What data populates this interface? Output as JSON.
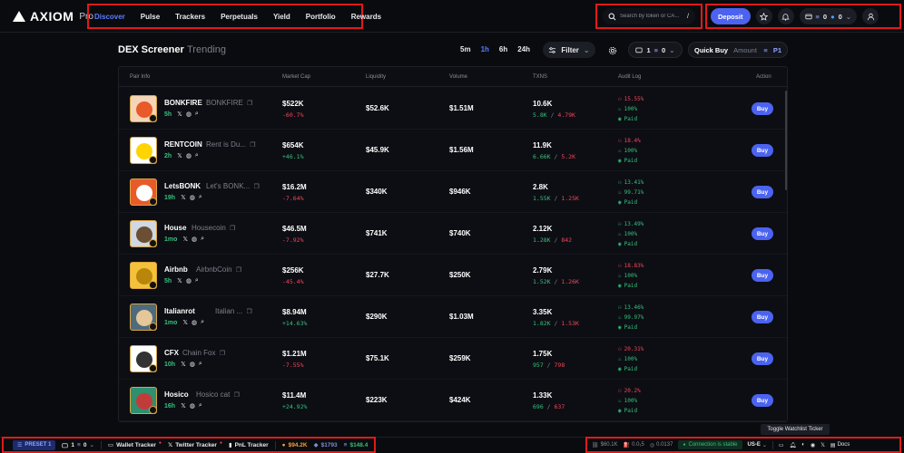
{
  "header": {
    "logo_text": "AXIOM",
    "logo_sub": "Pro",
    "nav": [
      "Discover",
      "Pulse",
      "Trackers",
      "Perpetuals",
      "Yield",
      "Portfolio",
      "Rewards"
    ],
    "search_placeholder": "Search by token or CA...",
    "search_shortcut": "/",
    "deposit_label": "Deposit",
    "wallet_sol": "0",
    "wallet_usdc": "0"
  },
  "toolbar": {
    "title": "DEX Screener",
    "trending": "Trending",
    "timeframes": [
      "5m",
      "1h",
      "6h",
      "24h"
    ],
    "active_timeframe": "1h",
    "filter_label": "Filter",
    "preset_count": "1",
    "preset_value": "0",
    "quick_buy_label": "Quick Buy",
    "amount_label": "Amount",
    "preset_tag": "P1"
  },
  "table": {
    "headers": [
      "Pair Info",
      "Market Cap",
      "Liquidity",
      "Volume",
      "TXNS",
      "Audit Log",
      "Action"
    ],
    "buy_label": "Buy",
    "rows": [
      {
        "symbol": "BONKFIRE",
        "name": "BONKFIRE",
        "age": "5h",
        "mc": "$522K",
        "mc_change": "-60.7%",
        "liq": "$52.6K",
        "vol": "$1.51M",
        "txns": "10.6K",
        "buys": "5.8K",
        "sells": "4.79K",
        "audit1": "15.55%",
        "audit2": "100%",
        "audit3": "Paid"
      },
      {
        "symbol": "RENTCOIN",
        "name": "Rent is Du...",
        "age": "2h",
        "mc": "$654K",
        "mc_change": "+46.1%",
        "liq": "$45.9K",
        "vol": "$1.56M",
        "txns": "11.9K",
        "buys": "6.66K",
        "sells": "5.2K",
        "audit1": "18.4%",
        "audit2": "100%",
        "audit3": "Paid"
      },
      {
        "symbol": "LetsBONK",
        "name": "Let's BONK...",
        "age": "19h",
        "mc": "$16.2M",
        "mc_change": "-7.64%",
        "liq": "$340K",
        "vol": "$946K",
        "txns": "2.8K",
        "buys": "1.55K",
        "sells": "1.25K",
        "audit1": "13.41%",
        "audit2": "99.71%",
        "audit3": "Paid"
      },
      {
        "symbol": "House",
        "name": "Housecoin",
        "age": "1mo",
        "mc": "$46.5M",
        "mc_change": "-7.92%",
        "liq": "$741K",
        "vol": "$740K",
        "txns": "2.12K",
        "buys": "1.28K",
        "sells": "842",
        "audit1": "13.49%",
        "audit2": "100%",
        "audit3": "Paid"
      },
      {
        "symbol": "Airbnb",
        "name": "AirbnbCoin",
        "age": "5h",
        "mc": "$256K",
        "mc_change": "-45.4%",
        "liq": "$27.7K",
        "vol": "$250K",
        "txns": "2.79K",
        "buys": "1.52K",
        "sells": "1.26K",
        "audit1": "18.83%",
        "audit2": "100%",
        "audit3": "Paid"
      },
      {
        "symbol": "Italianrot",
        "name": "Italian ...",
        "age": "1mo",
        "mc": "$8.94M",
        "mc_change": "+14.63%",
        "liq": "$290K",
        "vol": "$1.03M",
        "txns": "3.35K",
        "buys": "1.82K",
        "sells": "1.53K",
        "audit1": "13.46%",
        "audit2": "99.97%",
        "audit3": "Paid"
      },
      {
        "symbol": "CFX",
        "name": "Chain Fox",
        "age": "10h",
        "mc": "$1.21M",
        "mc_change": "-7.55%",
        "liq": "$75.1K",
        "vol": "$259K",
        "txns": "1.75K",
        "buys": "957",
        "sells": "798",
        "audit1": "20.31%",
        "audit2": "100%",
        "audit3": "Paid"
      },
      {
        "symbol": "Hosico",
        "name": "Hosico cat",
        "age": "16h",
        "mc": "$11.4M",
        "mc_change": "+24.92%",
        "liq": "$223K",
        "vol": "$424K",
        "txns": "1.33K",
        "buys": "696",
        "sells": "637",
        "audit1": "20.2%",
        "audit2": "100%",
        "audit3": "Paid"
      }
    ]
  },
  "tooltip": "Toggle Watchlist Ticker",
  "footer": {
    "preset_badge": "PRESET 1",
    "wallet_count": "1",
    "wallet_value": "0",
    "wallet_tracker": "Wallet Tracker",
    "twitter_tracker": "Twitter Tracker",
    "pnl_tracker": "PnL Tracker",
    "btc_price": "$94.2K",
    "eth_price": "$1793",
    "sol_price": "$148.4",
    "market_cap": "$60.1K",
    "gas": "0.0₁5",
    "fee": "0.0137",
    "connection": "Connection is stable",
    "region": "US-E",
    "docs": "Docs"
  }
}
